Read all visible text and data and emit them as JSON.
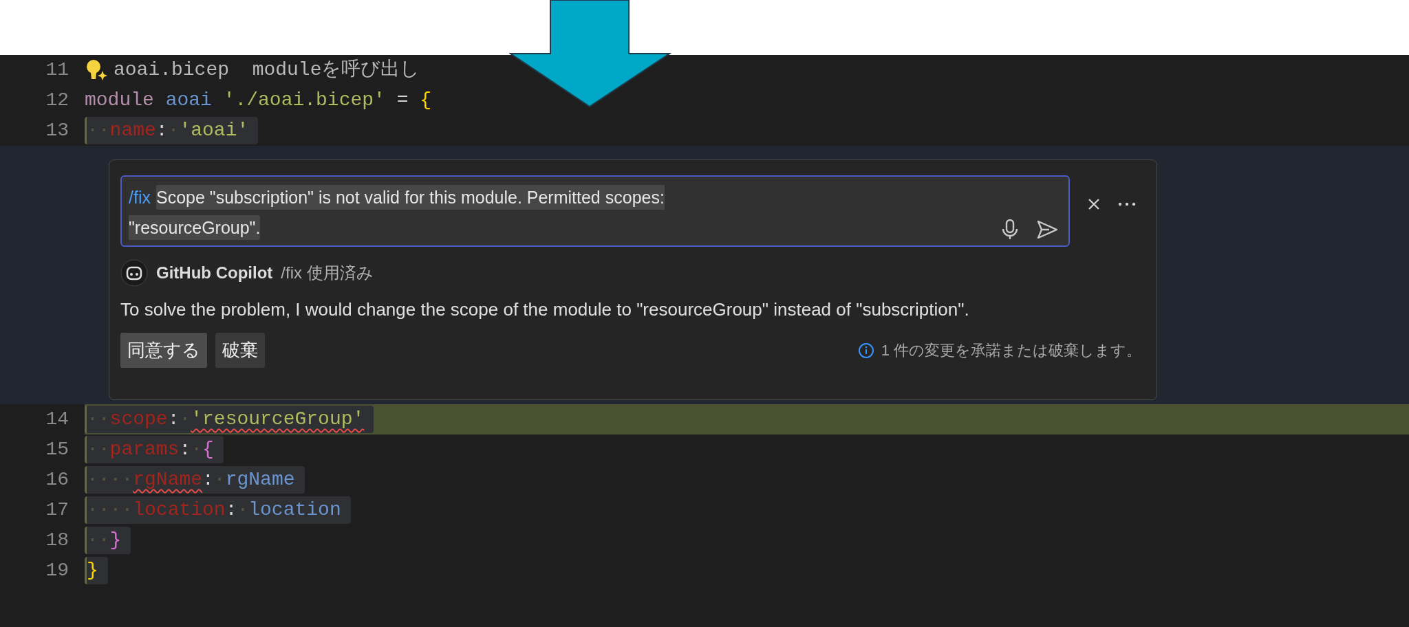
{
  "editor": {
    "lines_above": [
      {
        "number": "11",
        "lightbulb": true,
        "selected": false,
        "inserted": false,
        "tokens": [
          {
            "kind": "comment",
            "text": "aoai.bicep  moduleを呼び出し",
            "error": false,
            "spaced": false
          }
        ]
      },
      {
        "number": "12",
        "lightbulb": false,
        "selected": false,
        "inserted": false,
        "tokens": [
          {
            "kind": "keyword",
            "text": "module",
            "error": false,
            "spaced": false
          },
          {
            "kind": "identifier",
            "text": "aoai",
            "error": false,
            "spaced": true
          },
          {
            "kind": "string",
            "text": "'./aoai.bicep'",
            "error": false,
            "spaced": true
          },
          {
            "kind": "punct",
            "text": "=",
            "error": false,
            "spaced": true
          },
          {
            "kind": "brace1",
            "text": "{",
            "error": false,
            "spaced": true
          }
        ]
      },
      {
        "number": "13",
        "lightbulb": false,
        "selected": true,
        "inserted": false,
        "tokens": [
          {
            "kind": "whitespace",
            "text": "··",
            "error": false,
            "spaced": false
          },
          {
            "kind": "property",
            "text": "name",
            "error": false,
            "spaced": false
          },
          {
            "kind": "punct",
            "text": ":",
            "error": false,
            "spaced": false
          },
          {
            "kind": "whitespace",
            "text": "·",
            "error": false,
            "spaced": false
          },
          {
            "kind": "string",
            "text": "'aoai'",
            "error": false,
            "spaced": false
          }
        ]
      }
    ],
    "inline_chat": {
      "prompt": {
        "command": "/fix",
        "text": "Scope \"subscription\" is not valid for this module. Permitted scopes: \"resourceGroup\"."
      },
      "response": {
        "author": "GitHub Copilot",
        "meta": "/fix 使用済み",
        "message": "To solve the problem, I would change the scope of the module to \"resourceGroup\" instead of \"subscription\"."
      },
      "actions": [
        {
          "label": "同意する",
          "primary": true
        },
        {
          "label": "破棄",
          "primary": false
        }
      ],
      "status": "1 件の変更を承諾または破棄します。"
    },
    "lines_below": [
      {
        "number": "14",
        "lightbulb": false,
        "selected": true,
        "inserted": true,
        "tokens": [
          {
            "kind": "whitespace",
            "text": "··",
            "error": false,
            "spaced": false
          },
          {
            "kind": "property",
            "text": "scope",
            "error": false,
            "spaced": false
          },
          {
            "kind": "punct",
            "text": ":",
            "error": false,
            "spaced": false
          },
          {
            "kind": "whitespace",
            "text": "·",
            "error": false,
            "spaced": false
          },
          {
            "kind": "string",
            "text": "'resourceGroup'",
            "error": true,
            "spaced": false
          }
        ]
      },
      {
        "number": "15",
        "lightbulb": false,
        "selected": true,
        "inserted": false,
        "tokens": [
          {
            "kind": "whitespace",
            "text": "··",
            "error": false,
            "spaced": false
          },
          {
            "kind": "property",
            "text": "params",
            "error": false,
            "spaced": false
          },
          {
            "kind": "punct",
            "text": ":",
            "error": false,
            "spaced": false
          },
          {
            "kind": "whitespace",
            "text": "·",
            "error": false,
            "spaced": false
          },
          {
            "kind": "brace2",
            "text": "{",
            "error": false,
            "spaced": false
          }
        ]
      },
      {
        "number": "16",
        "lightbulb": false,
        "selected": true,
        "inserted": false,
        "tokens": [
          {
            "kind": "whitespace",
            "text": "····",
            "error": false,
            "spaced": false
          },
          {
            "kind": "property",
            "text": "rgName",
            "error": true,
            "spaced": false
          },
          {
            "kind": "punct",
            "text": ":",
            "error": false,
            "spaced": false
          },
          {
            "kind": "whitespace",
            "text": "·",
            "error": false,
            "spaced": false
          },
          {
            "kind": "identifier",
            "text": "rgName",
            "error": false,
            "spaced": false
          }
        ]
      },
      {
        "number": "17",
        "lightbulb": false,
        "selected": true,
        "inserted": false,
        "tokens": [
          {
            "kind": "whitespace",
            "text": "····",
            "error": false,
            "spaced": false
          },
          {
            "kind": "property",
            "text": "location",
            "error": false,
            "spaced": false
          },
          {
            "kind": "punct",
            "text": ":",
            "error": false,
            "spaced": false
          },
          {
            "kind": "whitespace",
            "text": "·",
            "error": false,
            "spaced": false
          },
          {
            "kind": "identifier",
            "text": "location",
            "error": false,
            "spaced": false
          }
        ]
      },
      {
        "number": "18",
        "lightbulb": false,
        "selected": true,
        "inserted": false,
        "tokens": [
          {
            "kind": "whitespace",
            "text": "··",
            "error": false,
            "spaced": false
          },
          {
            "kind": "brace2",
            "text": "}",
            "error": false,
            "spaced": false
          }
        ]
      },
      {
        "number": "19",
        "lightbulb": false,
        "selected": true,
        "inserted": false,
        "tokens": [
          {
            "kind": "brace1",
            "text": "}",
            "error": false,
            "spaced": false
          }
        ]
      }
    ]
  }
}
